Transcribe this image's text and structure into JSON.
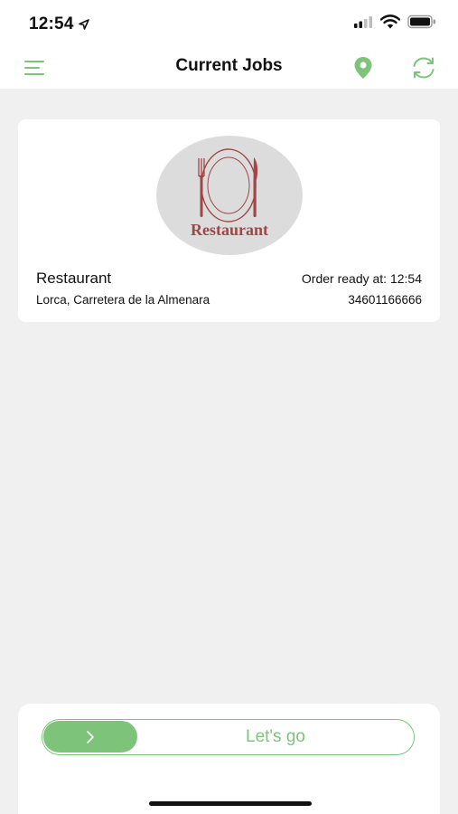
{
  "status_bar": {
    "time": "12:54"
  },
  "nav": {
    "title": "Current Jobs"
  },
  "job": {
    "logo_text": "Restaurant",
    "name": "Restaurant",
    "order_ready": "Order ready at: 12:54",
    "address": "Lorca, Carretera de la Almenara",
    "phone": "34601166666"
  },
  "slider": {
    "label": "Let's go"
  },
  "colors": {
    "accent": "#7dc47a",
    "logo_red": "#a04646",
    "background": "#f0f0f0"
  }
}
